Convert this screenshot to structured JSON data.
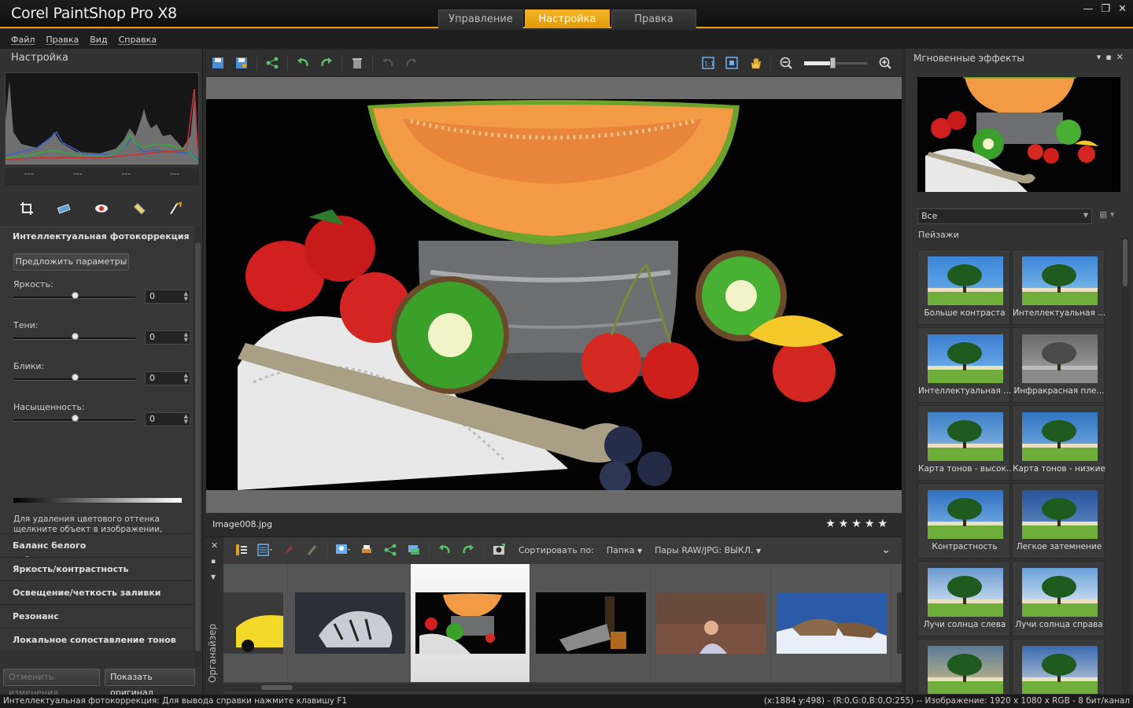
{
  "app": {
    "title": "Corel PaintShop Pro X8",
    "tabs": [
      "Управление",
      "Настройка",
      "Правка"
    ],
    "active_tab": 1
  },
  "menu": [
    "Файл",
    "Правка",
    "Вид",
    "Справка"
  ],
  "left_panel": {
    "title": "Настройка",
    "histogram_readout": [
      "---",
      "---",
      "---",
      "---"
    ],
    "tool_icons": [
      "crop-icon",
      "straighten-icon",
      "red-eye-icon",
      "retouch-icon",
      "depth-of-field-icon"
    ],
    "sfs_title": "Интеллектуальная фотокоррекция",
    "suggest_button": "Предложить параметры",
    "sliders": [
      {
        "label": "Яркость:",
        "value": "0",
        "level": 0.5
      },
      {
        "label": "Тени:",
        "value": "0",
        "level": 0.5
      },
      {
        "label": "Блики:",
        "value": "0",
        "level": 0.5
      },
      {
        "label": "Насыщенность:",
        "value": "0",
        "level": 0.5
      }
    ],
    "help_text": "Для удаления цветового оттенка щелкните объект в изображении, который должен быть черным, белым или серым. Для удаления точки выборки щелкните ее.",
    "sections": [
      "Баланс белого",
      "Яркость/контрастность",
      "Освещение/четкость заливки",
      "Резонанс",
      "Локальное сопоставление тонов"
    ],
    "undo_button": "Отменить изменения",
    "show_original_button": "Показать оригинал"
  },
  "center": {
    "filename": "Image008.jpg",
    "rating_stars": 5,
    "zoom_level": 0.45
  },
  "organizer": {
    "side_label": "Органайзер",
    "sort_label": "Сортировать по:",
    "sort_value": "Папка",
    "raw_pairs": "Пары RAW/JPG: ВЫКЛ.",
    "selected_index": 2
  },
  "right_panel": {
    "title": "Мгновенные эффекты",
    "category": "Все",
    "group": "Пейзажи",
    "presets": [
      "Больше контраста",
      "Интеллектуальная ...",
      "Интеллектуальная ...",
      "Инфракрасная пле...",
      "Карта тонов - высок...",
      "Карта тонов - низкие",
      "Контрастность",
      "Легкое затемнение",
      "Лучи солнца слева",
      "Лучи солнца справа",
      "",
      ""
    ]
  },
  "status": {
    "left": "Интеллектуальная фотокоррекция: Для вывода справки нажмите клавишу F1",
    "right": "(x:1884 y:498) - (R:0,G:0,B:0,O:255) -- Изображение:  1920 x 1080 x RGB - 8 бит/канал"
  },
  "colors": {
    "accent": "#e8a010",
    "panel": "#323232",
    "background": "#2b2b2b"
  }
}
